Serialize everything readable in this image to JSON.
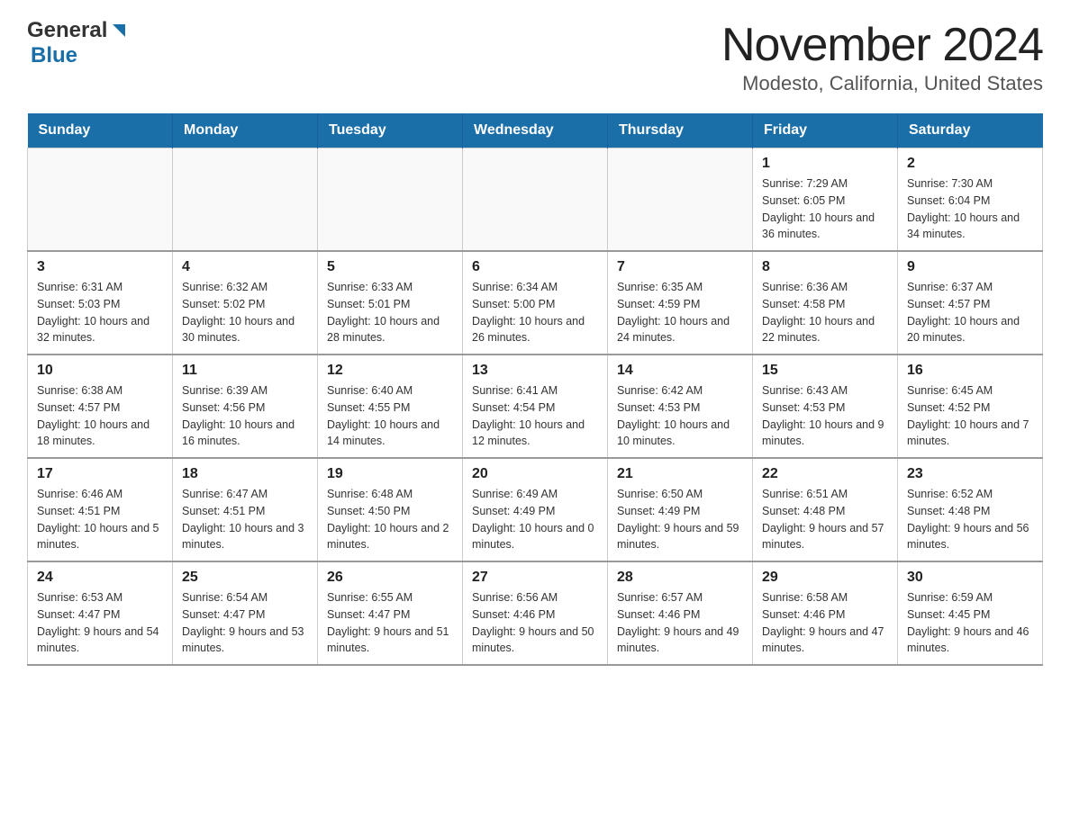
{
  "header": {
    "title": "November 2024",
    "subtitle": "Modesto, California, United States"
  },
  "logo": {
    "line1": "General",
    "line2": "Blue"
  },
  "days_header": [
    "Sunday",
    "Monday",
    "Tuesday",
    "Wednesday",
    "Thursday",
    "Friday",
    "Saturday"
  ],
  "weeks": [
    {
      "days": [
        {
          "num": "",
          "info": ""
        },
        {
          "num": "",
          "info": ""
        },
        {
          "num": "",
          "info": ""
        },
        {
          "num": "",
          "info": ""
        },
        {
          "num": "",
          "info": ""
        },
        {
          "num": "1",
          "info": "Sunrise: 7:29 AM\nSunset: 6:05 PM\nDaylight: 10 hours and 36 minutes."
        },
        {
          "num": "2",
          "info": "Sunrise: 7:30 AM\nSunset: 6:04 PM\nDaylight: 10 hours and 34 minutes."
        }
      ]
    },
    {
      "days": [
        {
          "num": "3",
          "info": "Sunrise: 6:31 AM\nSunset: 5:03 PM\nDaylight: 10 hours and 32 minutes."
        },
        {
          "num": "4",
          "info": "Sunrise: 6:32 AM\nSunset: 5:02 PM\nDaylight: 10 hours and 30 minutes."
        },
        {
          "num": "5",
          "info": "Sunrise: 6:33 AM\nSunset: 5:01 PM\nDaylight: 10 hours and 28 minutes."
        },
        {
          "num": "6",
          "info": "Sunrise: 6:34 AM\nSunset: 5:00 PM\nDaylight: 10 hours and 26 minutes."
        },
        {
          "num": "7",
          "info": "Sunrise: 6:35 AM\nSunset: 4:59 PM\nDaylight: 10 hours and 24 minutes."
        },
        {
          "num": "8",
          "info": "Sunrise: 6:36 AM\nSunset: 4:58 PM\nDaylight: 10 hours and 22 minutes."
        },
        {
          "num": "9",
          "info": "Sunrise: 6:37 AM\nSunset: 4:57 PM\nDaylight: 10 hours and 20 minutes."
        }
      ]
    },
    {
      "days": [
        {
          "num": "10",
          "info": "Sunrise: 6:38 AM\nSunset: 4:57 PM\nDaylight: 10 hours and 18 minutes."
        },
        {
          "num": "11",
          "info": "Sunrise: 6:39 AM\nSunset: 4:56 PM\nDaylight: 10 hours and 16 minutes."
        },
        {
          "num": "12",
          "info": "Sunrise: 6:40 AM\nSunset: 4:55 PM\nDaylight: 10 hours and 14 minutes."
        },
        {
          "num": "13",
          "info": "Sunrise: 6:41 AM\nSunset: 4:54 PM\nDaylight: 10 hours and 12 minutes."
        },
        {
          "num": "14",
          "info": "Sunrise: 6:42 AM\nSunset: 4:53 PM\nDaylight: 10 hours and 10 minutes."
        },
        {
          "num": "15",
          "info": "Sunrise: 6:43 AM\nSunset: 4:53 PM\nDaylight: 10 hours and 9 minutes."
        },
        {
          "num": "16",
          "info": "Sunrise: 6:45 AM\nSunset: 4:52 PM\nDaylight: 10 hours and 7 minutes."
        }
      ]
    },
    {
      "days": [
        {
          "num": "17",
          "info": "Sunrise: 6:46 AM\nSunset: 4:51 PM\nDaylight: 10 hours and 5 minutes."
        },
        {
          "num": "18",
          "info": "Sunrise: 6:47 AM\nSunset: 4:51 PM\nDaylight: 10 hours and 3 minutes."
        },
        {
          "num": "19",
          "info": "Sunrise: 6:48 AM\nSunset: 4:50 PM\nDaylight: 10 hours and 2 minutes."
        },
        {
          "num": "20",
          "info": "Sunrise: 6:49 AM\nSunset: 4:49 PM\nDaylight: 10 hours and 0 minutes."
        },
        {
          "num": "21",
          "info": "Sunrise: 6:50 AM\nSunset: 4:49 PM\nDaylight: 9 hours and 59 minutes."
        },
        {
          "num": "22",
          "info": "Sunrise: 6:51 AM\nSunset: 4:48 PM\nDaylight: 9 hours and 57 minutes."
        },
        {
          "num": "23",
          "info": "Sunrise: 6:52 AM\nSunset: 4:48 PM\nDaylight: 9 hours and 56 minutes."
        }
      ]
    },
    {
      "days": [
        {
          "num": "24",
          "info": "Sunrise: 6:53 AM\nSunset: 4:47 PM\nDaylight: 9 hours and 54 minutes."
        },
        {
          "num": "25",
          "info": "Sunrise: 6:54 AM\nSunset: 4:47 PM\nDaylight: 9 hours and 53 minutes."
        },
        {
          "num": "26",
          "info": "Sunrise: 6:55 AM\nSunset: 4:47 PM\nDaylight: 9 hours and 51 minutes."
        },
        {
          "num": "27",
          "info": "Sunrise: 6:56 AM\nSunset: 4:46 PM\nDaylight: 9 hours and 50 minutes."
        },
        {
          "num": "28",
          "info": "Sunrise: 6:57 AM\nSunset: 4:46 PM\nDaylight: 9 hours and 49 minutes."
        },
        {
          "num": "29",
          "info": "Sunrise: 6:58 AM\nSunset: 4:46 PM\nDaylight: 9 hours and 47 minutes."
        },
        {
          "num": "30",
          "info": "Sunrise: 6:59 AM\nSunset: 4:45 PM\nDaylight: 9 hours and 46 minutes."
        }
      ]
    }
  ]
}
